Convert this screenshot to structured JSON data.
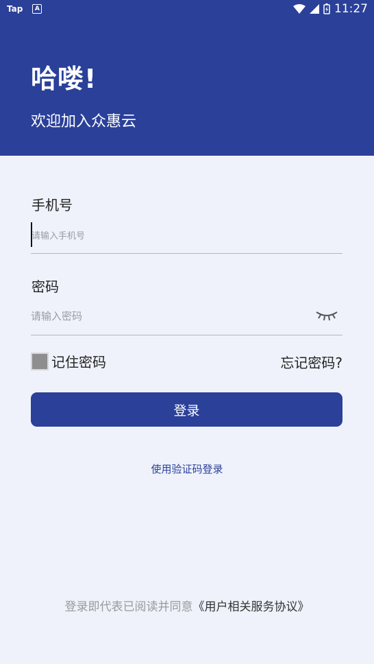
{
  "status_bar": {
    "carrier": "Tap",
    "app_badge": "A",
    "time": "11:27"
  },
  "header": {
    "greeting": "哈喽!",
    "welcome": "欢迎加入众惠云"
  },
  "form": {
    "phone_label": "手机号",
    "phone_placeholder": "请输入手机号",
    "password_label": "密码",
    "password_placeholder": "请输入密码",
    "remember_label": "记住密码",
    "forgot_label": "忘记密码?",
    "login_button": "登录",
    "code_login_link": "使用验证码登录"
  },
  "agreement": {
    "prefix": "登录即代表已阅读并同意",
    "link": "《用户相关服务协议》"
  },
  "colors": {
    "primary": "#2a4099",
    "background": "#eff2fb"
  }
}
